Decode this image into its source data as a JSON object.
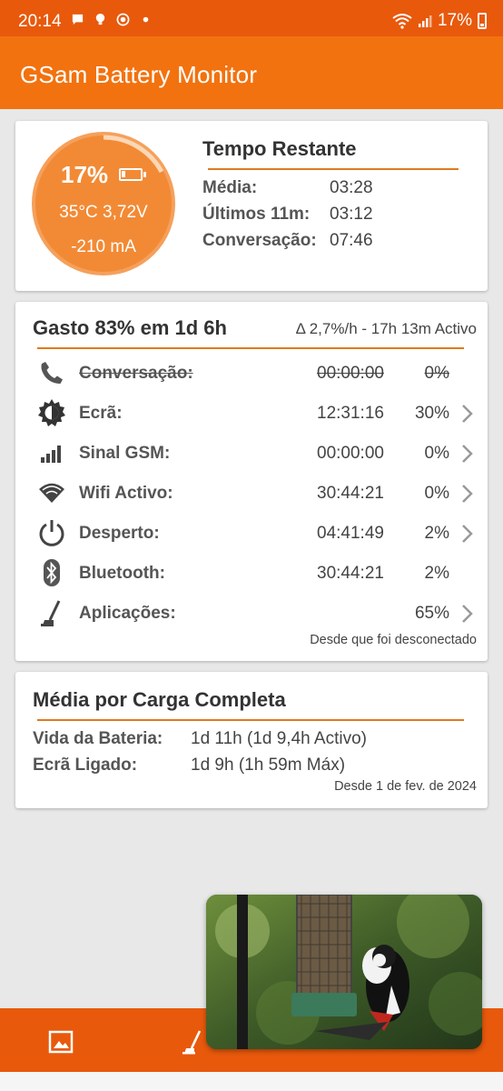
{
  "status_bar": {
    "time": "20:14",
    "battery_text": "17%",
    "left_icons": [
      "message-icon",
      "bulb-icon",
      "record-icon",
      "dot-icon"
    ],
    "right_icons": [
      "wifi-icon",
      "signal-icon",
      "battery-icon"
    ]
  },
  "app": {
    "title": "GSam Battery Monitor",
    "accent": "#f2720f",
    "status_color": "#e8590c"
  },
  "gauge": {
    "percent": "17%",
    "level": 0.17,
    "temp_volt": "35°C  3,72V",
    "current": "-210 mA"
  },
  "remaining": {
    "title": "Tempo Restante",
    "rows": [
      {
        "label": "Média:",
        "value": "03:28"
      },
      {
        "label": "Últimos 11m:",
        "value": "03:12"
      },
      {
        "label": "Conversação:",
        "value": "07:46"
      }
    ]
  },
  "usage": {
    "title": "Gasto 83% em 1d 6h",
    "rate": "Δ 2,7%/h - 17h 13m Activo",
    "rows": [
      {
        "icon": "phone-icon",
        "label": "Conversação:",
        "time": "00:00:00",
        "pct": "0%",
        "disabled": true,
        "chevron": false
      },
      {
        "icon": "screen-icon",
        "label": "Ecrã:",
        "time": "12:31:16",
        "pct": "30%",
        "disabled": false,
        "chevron": true
      },
      {
        "icon": "signal-bars-icon",
        "label": "Sinal GSM:",
        "time": "00:00:00",
        "pct": "0%",
        "disabled": false,
        "chevron": true
      },
      {
        "icon": "wifi-icon",
        "label": "Wifi Activo:",
        "time": "30:44:21",
        "pct": "0%",
        "disabled": false,
        "chevron": true
      },
      {
        "icon": "power-icon",
        "label": "Desperto:",
        "time": "04:41:49",
        "pct": "2%",
        "disabled": false,
        "chevron": true
      },
      {
        "icon": "bluetooth-icon",
        "label": "Bluetooth:",
        "time": "30:44:21",
        "pct": "2%",
        "disabled": false,
        "chevron": false
      },
      {
        "icon": "apps-icon",
        "label": "Aplicações:",
        "time": "",
        "pct": "65%",
        "disabled": false,
        "chevron": true
      }
    ],
    "footer": "Desde que foi desconectado"
  },
  "full_charge": {
    "title": "Média por Carga Completa",
    "rows": [
      {
        "label": "Vida da Bateria:",
        "value": "1d 11h (1d 9,4h Activo)"
      },
      {
        "label": "Ecrã Ligado:",
        "value": "1d 9h (1h 59m Máx)"
      }
    ],
    "footer": "Desde 1 de fev. de 2024"
  },
  "bottom_bar": {
    "icons": [
      "image-icon",
      "apps-icon"
    ]
  },
  "pip": {
    "content": "video-picture-in-picture"
  }
}
